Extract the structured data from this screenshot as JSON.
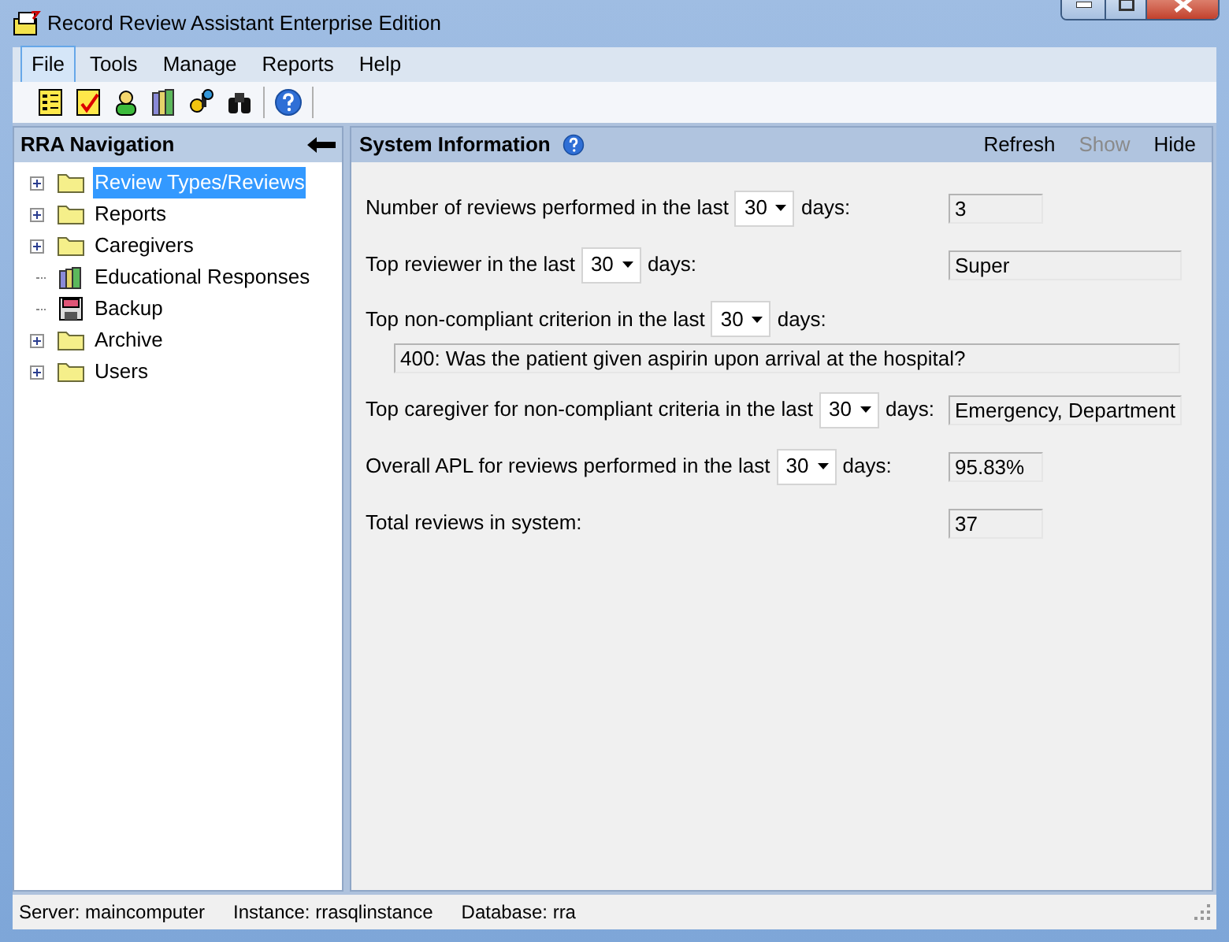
{
  "window": {
    "title": "Record Review Assistant Enterprise Edition"
  },
  "menu": [
    {
      "label": "File",
      "selected": true
    },
    {
      "label": "Tools",
      "selected": false
    },
    {
      "label": "Manage",
      "selected": false
    },
    {
      "label": "Reports",
      "selected": false
    },
    {
      "label": "Help",
      "selected": false
    }
  ],
  "toolbar": {
    "tools": [
      {
        "kind": "list"
      },
      {
        "kind": "check"
      },
      {
        "kind": "person"
      },
      {
        "kind": "books"
      },
      {
        "kind": "keys"
      },
      {
        "kind": "binoculars"
      }
    ],
    "help": {
      "kind": "help"
    }
  },
  "navigation": {
    "title": "RRA Navigation",
    "items": [
      {
        "label": "Review Types/Reviews",
        "kind": "folder",
        "expandable": true,
        "selected": true
      },
      {
        "label": "Reports",
        "kind": "folder",
        "expandable": true,
        "selected": false
      },
      {
        "label": "Caregivers",
        "kind": "folder",
        "expandable": true,
        "selected": false
      },
      {
        "label": "Educational Responses",
        "kind": "books",
        "expandable": false,
        "selected": false
      },
      {
        "label": "Backup",
        "kind": "disk",
        "expandable": false,
        "selected": false
      },
      {
        "label": "Archive",
        "kind": "folder",
        "expandable": true,
        "selected": false
      },
      {
        "label": "Users",
        "kind": "folder",
        "expandable": true,
        "selected": false
      }
    ]
  },
  "panel": {
    "title": "System Information",
    "actions": [
      {
        "label": "Refresh",
        "disabled": false
      },
      {
        "label": "Show",
        "disabled": true
      },
      {
        "label": "Hide",
        "disabled": false
      }
    ],
    "rows": [
      {
        "kind": "short",
        "label": "Number of reviews performed in the last",
        "period": "30",
        "suffix": "days:",
        "value": "3"
      },
      {
        "kind": "long",
        "label": "Top reviewer in the last",
        "period": "30",
        "suffix": "days:",
        "value": "Super"
      },
      {
        "kind": "below",
        "label": "Top non-compliant criterion in the last",
        "period": "30",
        "suffix": "days:",
        "value": "400: Was the patient given aspirin upon arrival at the hospital?"
      },
      {
        "kind": "long",
        "label": "Top caregiver for non-compliant criteria in the last",
        "period": "30",
        "suffix": "days:",
        "value": "Emergency, Department"
      },
      {
        "kind": "short",
        "label": "Overall APL for reviews performed in the last",
        "period": "30",
        "suffix": "days:",
        "value": "95.83%"
      },
      {
        "kind": "short",
        "label": "Total reviews in system:",
        "value": "37"
      }
    ]
  },
  "status_bar": [
    "Server: maincomputer",
    "Instance: rrasqlinstance",
    "Database: rra"
  ]
}
